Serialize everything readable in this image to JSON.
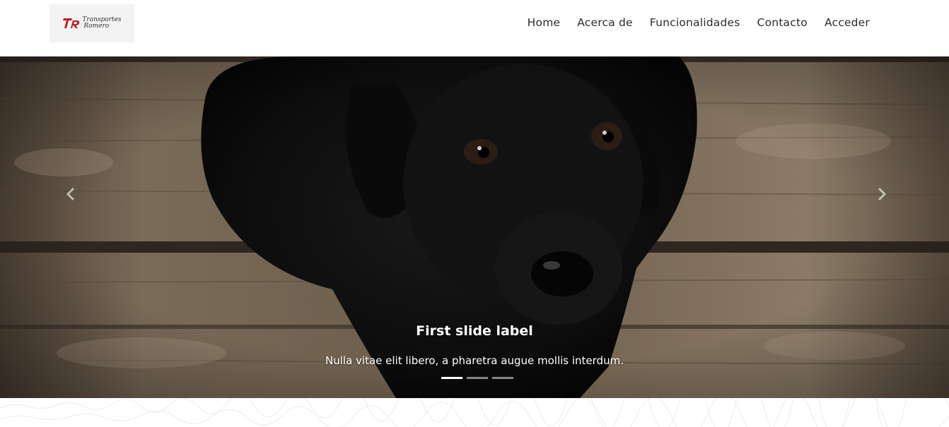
{
  "brand": {
    "line1": "Transportes",
    "line2": "Romero",
    "mark_color": "#c0191d"
  },
  "nav": {
    "items": [
      {
        "label": "Home"
      },
      {
        "label": "Acerca de"
      },
      {
        "label": "Funcionalidades"
      },
      {
        "label": "Contacto"
      },
      {
        "label": "Acceder"
      }
    ]
  },
  "carousel": {
    "title": "First slide label",
    "text": "Nulla vitae elit libero, a pharetra augue mollis interdum.",
    "prev_icon": "chevron-left-icon",
    "next_icon": "chevron-right-icon",
    "slide_count": 3,
    "active_index": 0
  }
}
